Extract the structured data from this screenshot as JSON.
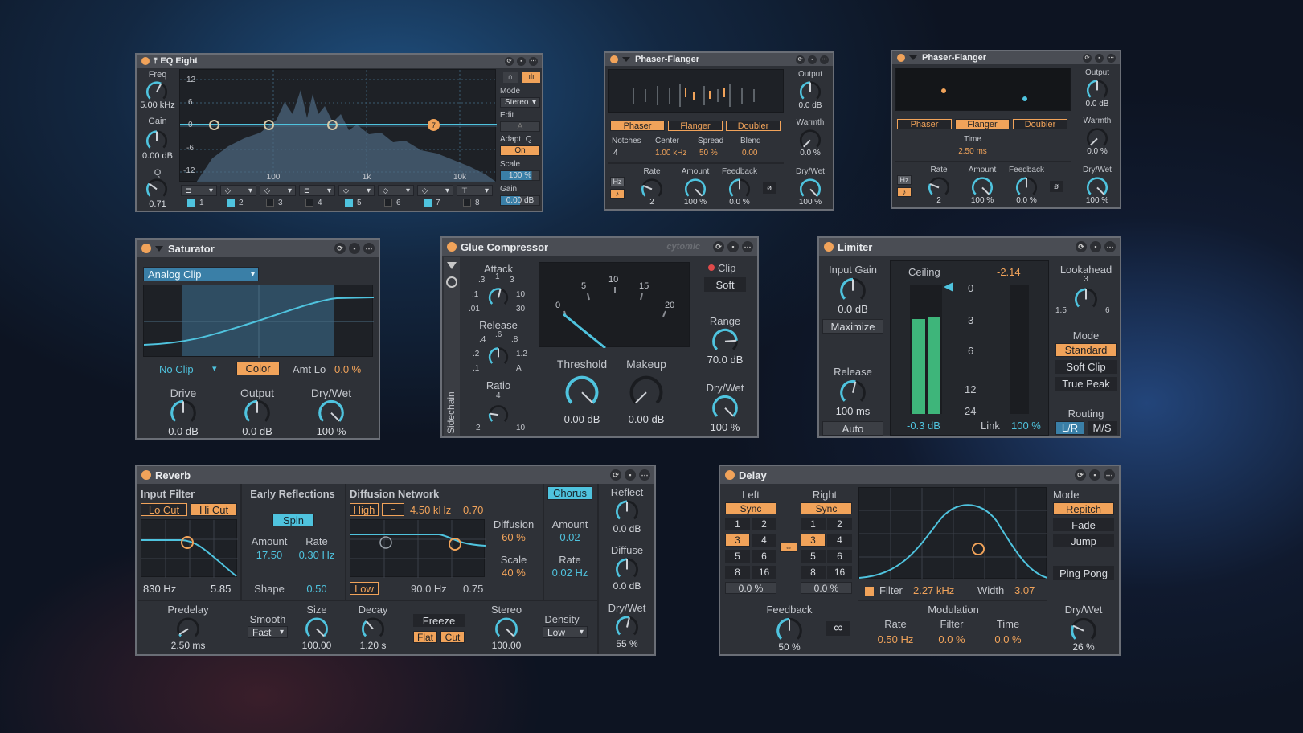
{
  "eq": {
    "title": "EQ Eight",
    "freq_label": "Freq",
    "freq_value": "5.00 kHz",
    "gain_label": "Gain",
    "gain_value": "0.00 dB",
    "q_label": "Q",
    "q_value": "0.71",
    "db_ticks": [
      "12",
      "6",
      "0",
      "-6",
      "-12"
    ],
    "freq_ticks": [
      "100",
      "1k",
      "10k"
    ],
    "bands": [
      "1",
      "2",
      "3",
      "4",
      "5",
      "6",
      "7",
      "8"
    ],
    "band7": "7",
    "mode_label": "Mode",
    "mode_value": "Stereo",
    "edit_label": "Edit",
    "edit_value": "A",
    "adaptq_label": "Adapt. Q",
    "adaptq_value": "On",
    "scale_label": "Scale",
    "scale_value": "100 %",
    "gainr_label": "Gain",
    "gainr_value": "0.00 dB"
  },
  "pf1": {
    "title": "Phaser-Flanger",
    "output_label": "Output",
    "output_value": "0.0 dB",
    "warmth_label": "Warmth",
    "warmth_value": "0.0 %",
    "drywet_label": "Dry/Wet",
    "drywet_value": "100 %",
    "modes": [
      "Phaser",
      "Flanger",
      "Doubler"
    ],
    "notches_label": "Notches",
    "notches_value": "4",
    "center_label": "Center",
    "center_value": "1.00 kHz",
    "spread_label": "Spread",
    "spread_value": "50 %",
    "blend_label": "Blend",
    "blend_value": "0.00",
    "hz": "Hz",
    "note": "♪",
    "rate_label": "Rate",
    "rate_value": "2",
    "amount_label": "Amount",
    "amount_value": "100 %",
    "feedback_label": "Feedback",
    "feedback_value": "0.0 %",
    "phase": "ø"
  },
  "pf2": {
    "title": "Phaser-Flanger",
    "output_label": "Output",
    "output_value": "0.0 dB",
    "warmth_label": "Warmth",
    "warmth_value": "0.0 %",
    "drywet_label": "Dry/Wet",
    "drywet_value": "100 %",
    "modes": [
      "Phaser",
      "Flanger",
      "Doubler"
    ],
    "time_label": "Time",
    "time_value": "2.50 ms",
    "hz": "Hz",
    "note": "♪",
    "rate_label": "Rate",
    "rate_value": "2",
    "amount_label": "Amount",
    "amount_value": "100 %",
    "feedback_label": "Feedback",
    "feedback_value": "0.0 %",
    "phase": "ø"
  },
  "sat": {
    "title": "Saturator",
    "type": "Analog Clip",
    "noclip": "No Clip",
    "color": "Color",
    "amtlo_label": "Amt Lo",
    "amtlo_value": "0.0 %",
    "drive_label": "Drive",
    "drive_value": "0.0 dB",
    "output_label": "Output",
    "output_value": "0.0 dB",
    "drywet_label": "Dry/Wet",
    "drywet_value": "100 %"
  },
  "glue": {
    "title": "Glue Compressor",
    "brand": "cytomic",
    "sidechain": "Sidechain",
    "attack_label": "Attack",
    "attack_ticks": [
      ".3",
      "1",
      "3",
      ".1",
      "10",
      ".01",
      "30"
    ],
    "release_label": "Release",
    "release_ticks": [
      ".6",
      ".4",
      ".8",
      ".2",
      "1.2",
      ".1",
      "A"
    ],
    "ratio_label": "Ratio",
    "ratio_ticks": [
      "4",
      "2",
      "10"
    ],
    "meter_ticks": [
      "0",
      "5",
      "10",
      "15",
      "20"
    ],
    "threshold_label": "Threshold",
    "threshold_value": "0.00 dB",
    "makeup_label": "Makeup",
    "makeup_value": "0.00 dB",
    "clip_label": "Clip",
    "soft": "Soft",
    "range_label": "Range",
    "range_value": "70.0 dB",
    "drywet_label": "Dry/Wet",
    "drywet_value": "100 %"
  },
  "lim": {
    "title": "Limiter",
    "input_label": "Input Gain",
    "input_value": "0.0 dB",
    "maximize": "Maximize",
    "release_label": "Release",
    "release_value": "100 ms",
    "auto": "Auto",
    "ceiling_label": "Ceiling",
    "ceiling_value": "-2.14",
    "scale": [
      "0",
      "3",
      "6",
      "12",
      "24"
    ],
    "peak_value": "-0.3 dB",
    "link_label": "Link",
    "link_value": "100 %",
    "lookahead_label": "Lookahead",
    "la_ticks": [
      "3",
      "1.5",
      "6"
    ],
    "mode_label": "Mode",
    "modes": [
      "Standard",
      "Soft Clip",
      "True Peak"
    ],
    "routing_label": "Routing",
    "lr": "L/R",
    "ms": "M/S"
  },
  "rev": {
    "title": "Reverb",
    "input_filter": "Input Filter",
    "locut": "Lo Cut",
    "hicut": "Hi Cut",
    "if_freq": "830 Hz",
    "if_q": "5.85",
    "early": "Early Reflections",
    "spin": "Spin",
    "er_amount_label": "Amount",
    "er_amount_value": "17.50",
    "er_rate_label": "Rate",
    "er_rate_value": "0.30 Hz",
    "shape_label": "Shape",
    "shape_value": "0.50",
    "diff_net": "Diffusion Network",
    "high": "High",
    "dn_freq": "4.50 kHz",
    "dn_val": "0.70",
    "low": "Low",
    "low_freq": "90.0 Hz",
    "low_val": "0.75",
    "diffusion_label": "Diffusion",
    "diffusion_value": "60 %",
    "scale_label": "Scale",
    "scale_value": "40 %",
    "chorus": "Chorus",
    "ch_amount_label": "Amount",
    "ch_amount_value": "0.02",
    "ch_rate_label": "Rate",
    "ch_rate_value": "0.02 Hz",
    "reflect_label": "Reflect",
    "reflect_value": "0.0 dB",
    "diffuse_label": "Diffuse",
    "diffuse_value": "0.0 dB",
    "drywet_label": "Dry/Wet",
    "drywet_value": "55 %",
    "predelay_label": "Predelay",
    "predelay_value": "2.50 ms",
    "smooth_label": "Smooth",
    "smooth_value": "Fast",
    "size_label": "Size",
    "size_value": "100.00",
    "decay_label": "Decay",
    "decay_value": "1.20 s",
    "freeze": "Freeze",
    "flat": "Flat",
    "cut": "Cut",
    "stereo_label": "Stereo",
    "stereo_value": "100.00",
    "density_label": "Density",
    "density_value": "Low"
  },
  "delay": {
    "title": "Delay",
    "left_label": "Left",
    "right_label": "Right",
    "sync": "Sync",
    "grid": [
      "1",
      "2",
      "3",
      "4",
      "5",
      "6",
      "8",
      "16"
    ],
    "left_offset": "0.0 %",
    "right_offset": "0.0 %",
    "feedback_label": "Feedback",
    "feedback_value": "50 %",
    "infinity": "∞",
    "filter_label": "Filter",
    "filter_value": "2.27 kHz",
    "width_label": "Width",
    "width_value": "3.07",
    "modulation_label": "Modulation",
    "mrate_label": "Rate",
    "mrate_value": "0.50 Hz",
    "mfilter_label": "Filter",
    "mfilter_value": "0.0 %",
    "mtime_label": "Time",
    "mtime_value": "0.0 %",
    "mode_label": "Mode",
    "modes": [
      "Repitch",
      "Fade",
      "Jump"
    ],
    "pingpong": "Ping Pong",
    "drywet_label": "Dry/Wet",
    "drywet_value": "26 %"
  },
  "knobs": {
    "eq_freq": 0.6,
    "eq_gain": 0.5,
    "eq_q": 0.3,
    "pf_output": 0.5,
    "pf_warmth": 0,
    "pf_drywet": 1,
    "pf_rate": 0.25,
    "pf_amount": 1,
    "pf_feedback": 0.5,
    "sat_drive": 0.5,
    "sat_output": 0.5,
    "sat_drywet": 1,
    "glue_attack": 0.55,
    "glue_release": 0.5,
    "glue_ratio": 0.2,
    "glue_threshold": 1,
    "glue_makeup": 0,
    "glue_range": 0.82,
    "glue_drywet": 1,
    "lim_input": 0.5,
    "lim_release": 0.55,
    "lim_lookahead": 0.5,
    "rev_predelay": 0.05,
    "rev_size": 1,
    "rev_decay": 0.35,
    "rev_stereo": 1,
    "rev_reflect": 0.5,
    "rev_diffuse": 0.5,
    "rev_drywet": 0.55,
    "delay_feedback": 0.5,
    "delay_drywet": 0.26
  },
  "colors": {
    "accent": "#f1a35a",
    "blue": "#4fc3de",
    "panel": "#2e3137",
    "header": "#4a4d54",
    "meter": "#3eb57a"
  }
}
